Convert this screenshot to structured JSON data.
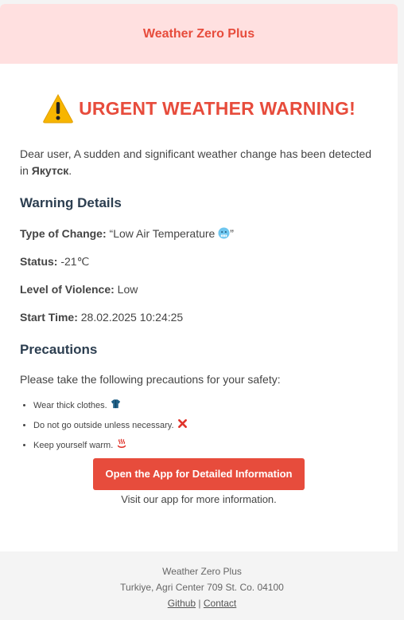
{
  "header": {
    "title": "Weather Zero Plus"
  },
  "urgent": {
    "title": "URGENT WEATHER WARNING!"
  },
  "intro": {
    "text": "Dear user, A sudden and significant weather change has been detected in ",
    "city": "Якутск",
    "end": "."
  },
  "warning": {
    "title": "Warning Details",
    "type_label": "Type of Change:",
    "type_value_open": " “Low Air Temperature ",
    "type_value_close": "”",
    "status_label": "Status:",
    "status_value": " -21℃",
    "violence_label": "Level of Violence:",
    "violence_value": " Low",
    "start_label": "Start Time:",
    "start_value": " 28.02.2025 10:24:25"
  },
  "precautions": {
    "title": "Precautions",
    "intro": "Please take the following precautions for your safety:",
    "items": [
      {
        "text": "Wear thick clothes.",
        "icon": "coat-icon"
      },
      {
        "text": "Do not go outside unless necessary.",
        "icon": "cross-icon"
      },
      {
        "text": "Keep yourself warm.",
        "icon": "hot-springs-icon"
      }
    ]
  },
  "cta": {
    "label": "Open the App for Detailed Information",
    "sub": "Visit our app for more information."
  },
  "footer": {
    "name": "Weather Zero Plus",
    "address": "Turkiye, Agri Center 709 St. Co. 04100",
    "github": "Github",
    "separator": " | ",
    "contact": "Contact"
  },
  "colors": {
    "accent": "#e74c3c",
    "header_bg": "#ffe0e0",
    "heading": "#2c3e50",
    "page_bg": "#f4f4f4"
  }
}
